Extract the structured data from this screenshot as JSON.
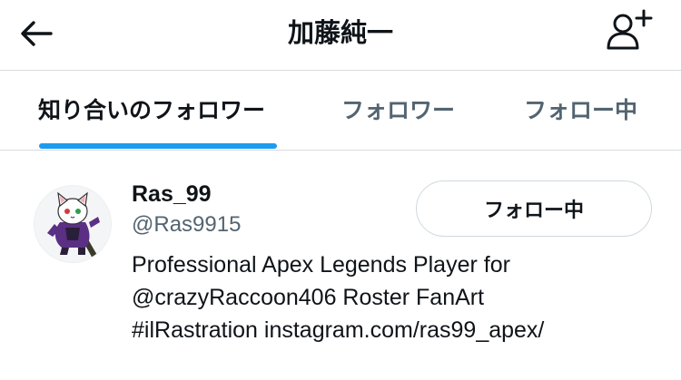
{
  "header": {
    "title": "加藤純一"
  },
  "tabs": [
    {
      "label": "知り合いのフォロワー",
      "active": true
    },
    {
      "label": "フォロワー",
      "active": false
    },
    {
      "label": "フォロー中",
      "active": false
    }
  ],
  "user": {
    "name": "Ras_99",
    "handle": "@Ras9915",
    "follow_button_label": "フォロー中",
    "bio_lines": [
      "Professional Apex Legends Player for",
      "@crazyRaccoon406 Roster FanArt",
      "#ilRastration instagram.com/ras99_apex/"
    ]
  },
  "colors": {
    "accent": "#1d9bf0",
    "text_primary": "#0f1419",
    "text_secondary": "#536471",
    "divider": "#d7dbdf"
  },
  "icons": {
    "back": "arrow-left-icon",
    "add_user": "add-user-icon"
  }
}
